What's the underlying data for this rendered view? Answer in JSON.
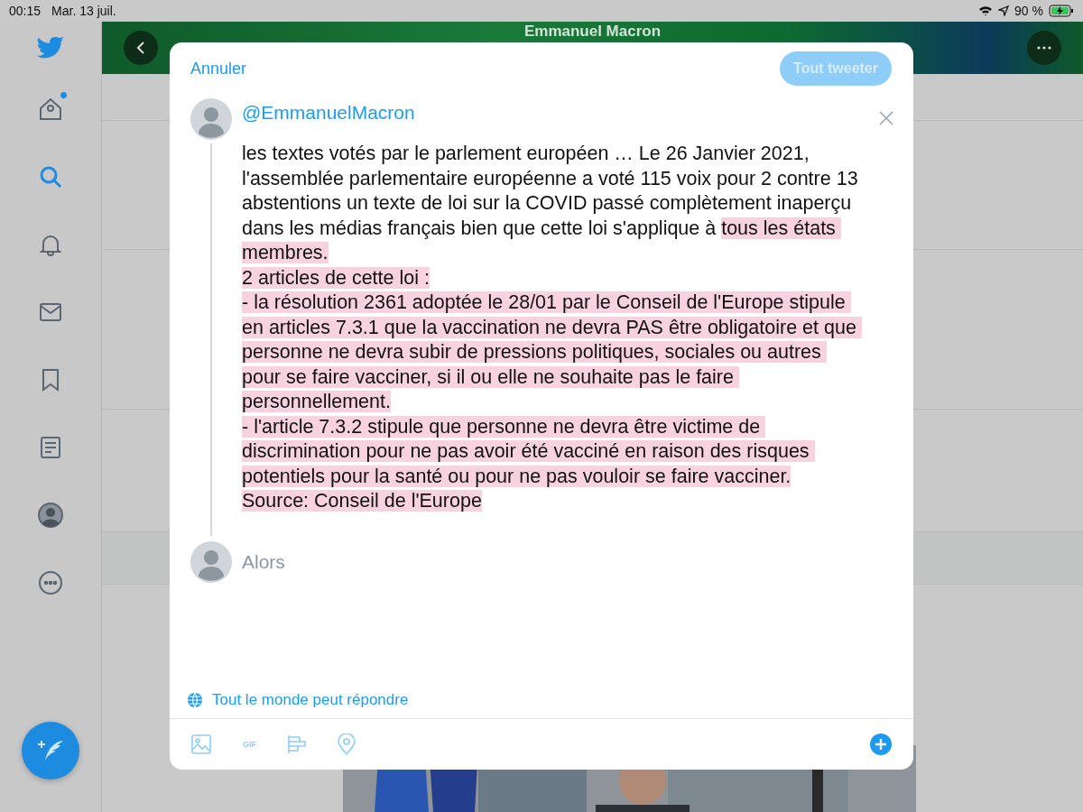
{
  "status_bar": {
    "time": "00:15",
    "date": "Mar. 13 juil.",
    "battery": "90 %"
  },
  "sidebar": {
    "items": [
      {
        "kind": "home",
        "selected": false,
        "dot": true
      },
      {
        "kind": "search",
        "selected": true,
        "dot": false
      },
      {
        "kind": "notifications",
        "selected": false,
        "dot": false
      },
      {
        "kind": "messages",
        "selected": false,
        "dot": false
      },
      {
        "kind": "bookmarks",
        "selected": false,
        "dot": false
      },
      {
        "kind": "lists",
        "selected": false,
        "dot": false
      },
      {
        "kind": "profile",
        "selected": false,
        "dot": false
      },
      {
        "kind": "more",
        "selected": false,
        "dot": false
      }
    ]
  },
  "header": {
    "title": "Emmanuel Macron"
  },
  "compose": {
    "cancel": "Annuler",
    "submit": {
      "label": "Tout tweeter",
      "disabled": true
    },
    "tweets": [
      {
        "handle": "@EmmanuelMacron",
        "text": "les textes votés par le parlement européen … Le 26 Janvier 2021, l'assemblée parlementaire européenne a voté 115 voix pour 2 contre 13 abstentions un texte de loi sur la COVID passé complètement inaperçu dans les médias français bien que cette loi s'applique à ",
        "highlighted_text": "tous les états membres.\n2 articles de cette loi :\n- la résolution 2361 adoptée le 28/01 par le Conseil de l'Europe stipule en articles 7.3.1 que la vaccination ne devra PAS être obligatoire et que personne ne devra subir de pressions politiques, sociales ou autres pour se faire vacciner, si il ou elle ne souhaite pas le faire personnellement.\n- l'article 7.3.2 stipule que personne ne devra être victime de discrimination pour ne pas avoir été vacciné en raison des risques potentiels pour la santé ou pour ne pas vouloir se faire vacciner.\nSource: Conseil de l'Europe"
      }
    ],
    "reply": {
      "placeholder": "Alors"
    },
    "reply_setting": "Tout le monde peut répondre",
    "toolbar": {
      "gif": "GIF"
    }
  }
}
